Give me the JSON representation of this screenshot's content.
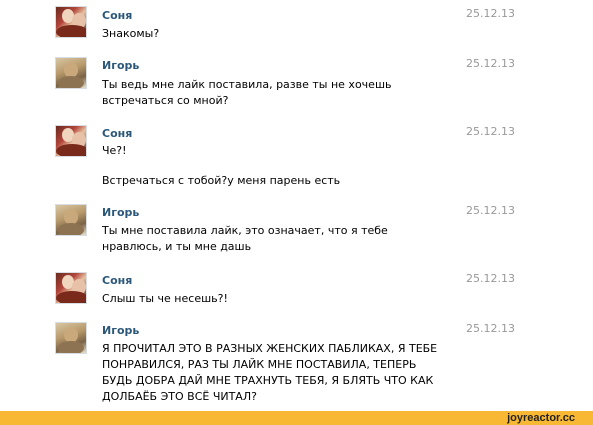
{
  "messages": [
    {
      "author": "Соня",
      "date": "25.12.13",
      "lines": [
        "Знакомы?"
      ],
      "avatar": "sonya"
    },
    {
      "author": "Игорь",
      "date": "25.12.13",
      "lines": [
        "Ты ведь мне лайк поставила, разве ты не хочешь встречаться со мной?"
      ],
      "avatar": "igor"
    },
    {
      "author": "Соня",
      "date": "25.12.13",
      "lines": [
        "Че?!",
        "Встречаться с тобой?у меня парень есть"
      ],
      "avatar": "sonya"
    },
    {
      "author": "Игорь",
      "date": "25.12.13",
      "lines": [
        "Ты мне поставила лайк, это означает, что я тебе нравлюсь, и ты мне дашь"
      ],
      "avatar": "igor"
    },
    {
      "author": "Соня",
      "date": "25.12.13",
      "lines": [
        "Слыш ты че несешь?!"
      ],
      "avatar": "sonya"
    },
    {
      "author": "Игорь",
      "date": "25.12.13",
      "lines": [
        "Я ПРОЧИТАЛ ЭТО В РАЗНЫХ ЖЕНСКИХ ПАБЛИКАХ, Я ТЕБЕ ПОНРАВИЛСЯ, РАЗ ТЫ ЛАЙК МНЕ ПОСТАВИЛА, ТЕПЕРЬ БУДЬ ДОБРА ДАЙ МНЕ ТРАХНУТЬ ТЕБЯ, Я БЛЯТЬ ЧТО КАК ДОЛБАЁБ ЭТО ВСЁ ЧИТАЛ?"
      ],
      "avatar": "igor"
    }
  ],
  "footer": {
    "watermark": "joyreactor.cc",
    "color": "#f9b834"
  },
  "colors": {
    "author": "#2b587a",
    "date": "#999999",
    "text": "#000000"
  }
}
